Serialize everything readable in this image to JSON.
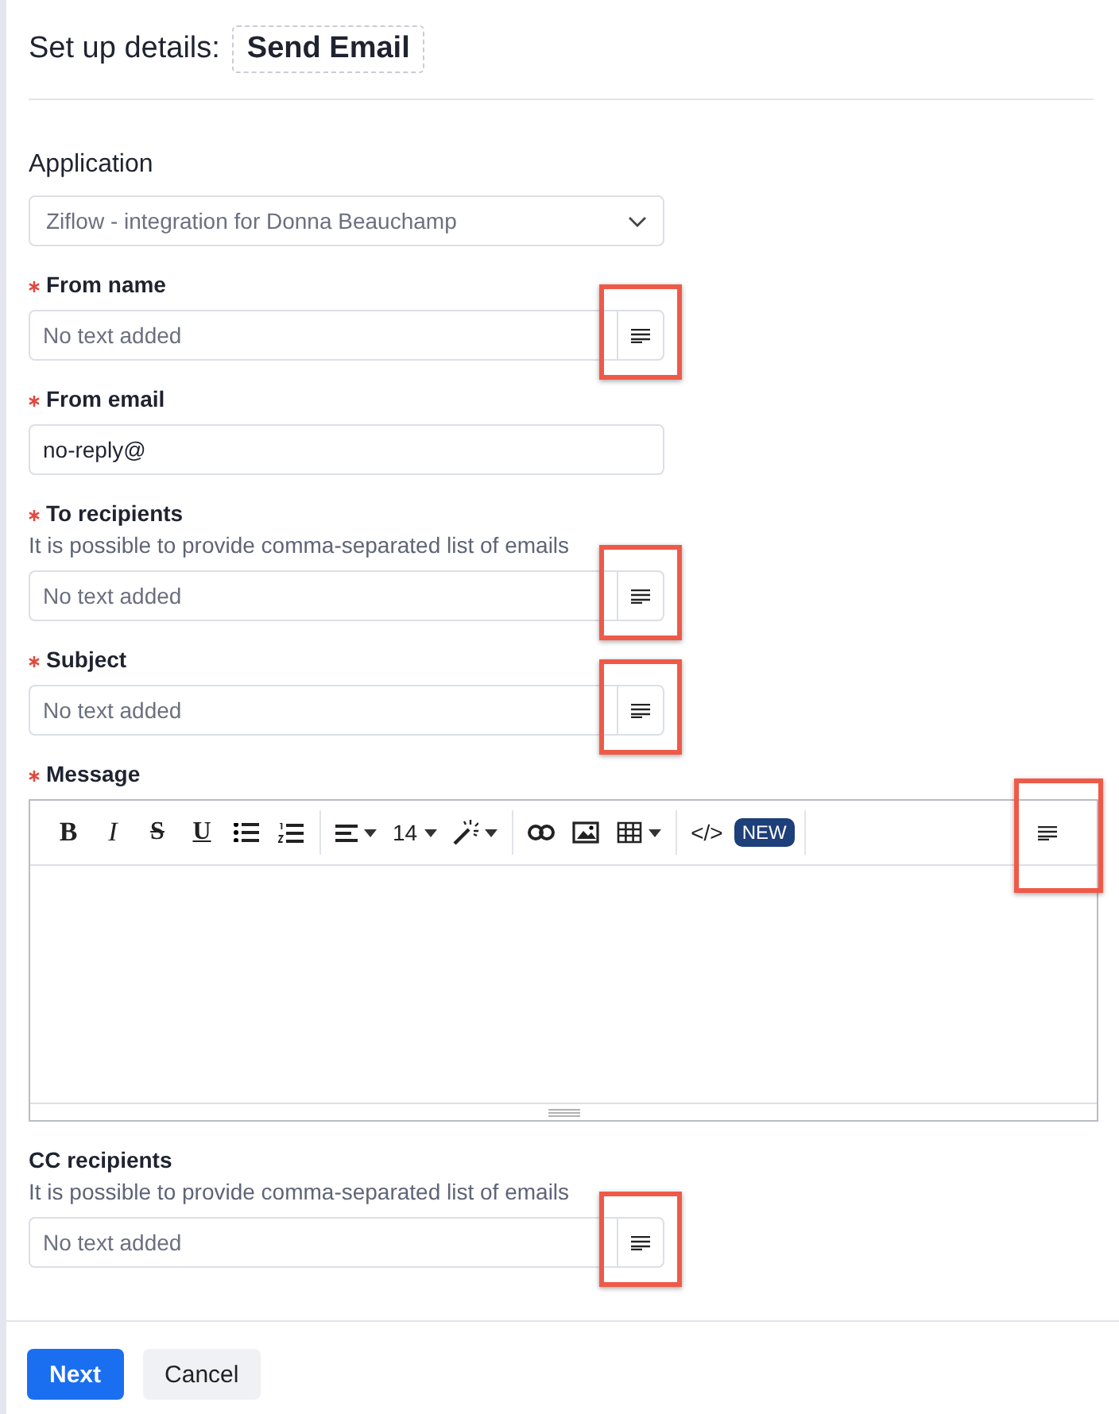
{
  "header": {
    "title": "Set up details:",
    "step_name": "Send Email"
  },
  "application": {
    "label": "Application",
    "value": "Ziflow - integration for Donna Beauchamp"
  },
  "fields": [
    {
      "kind": "text",
      "label": "From name",
      "required": true,
      "placeholder": "No text added",
      "highlighted": true
    },
    {
      "kind": "plain",
      "label": "From email",
      "required": true,
      "value": "no-reply@"
    },
    {
      "kind": "text",
      "label": "To recipients",
      "required": true,
      "hint": "It is possible to provide comma-separated list of emails",
      "placeholder": "No text added",
      "highlighted": true
    },
    {
      "kind": "text",
      "label": "Subject",
      "required": true,
      "placeholder": "No text added",
      "highlighted": true
    },
    {
      "kind": "editor",
      "label": "Message",
      "required": true,
      "highlighted": true,
      "toolbar": [
        [
          {
            "kind": "bold",
            "label": "B"
          },
          {
            "kind": "italic",
            "label": "I"
          },
          {
            "kind": "strike",
            "label": "S"
          },
          {
            "kind": "underline",
            "label": "U"
          },
          {
            "kind": "bullets"
          },
          {
            "kind": "numbers"
          }
        ],
        [
          {
            "kind": "align",
            "dropdown": true
          },
          {
            "kind": "size",
            "label": "14",
            "dropdown": true
          },
          {
            "kind": "magic",
            "dropdown": true
          }
        ],
        [
          {
            "kind": "link"
          },
          {
            "kind": "image"
          },
          {
            "kind": "table",
            "dropdown": true
          }
        ],
        [
          {
            "kind": "code",
            "label": "</>"
          },
          {
            "kind": "badge",
            "label": "NEW"
          }
        ]
      ]
    },
    {
      "kind": "text",
      "label": "CC recipients",
      "required": false,
      "hint": "It is possible to provide comma-separated list of emails",
      "placeholder": "No text added",
      "highlighted": true
    }
  ],
  "buttons": [
    {
      "label": "Next",
      "primary": true
    },
    {
      "label": "Cancel",
      "primary": false
    }
  ]
}
